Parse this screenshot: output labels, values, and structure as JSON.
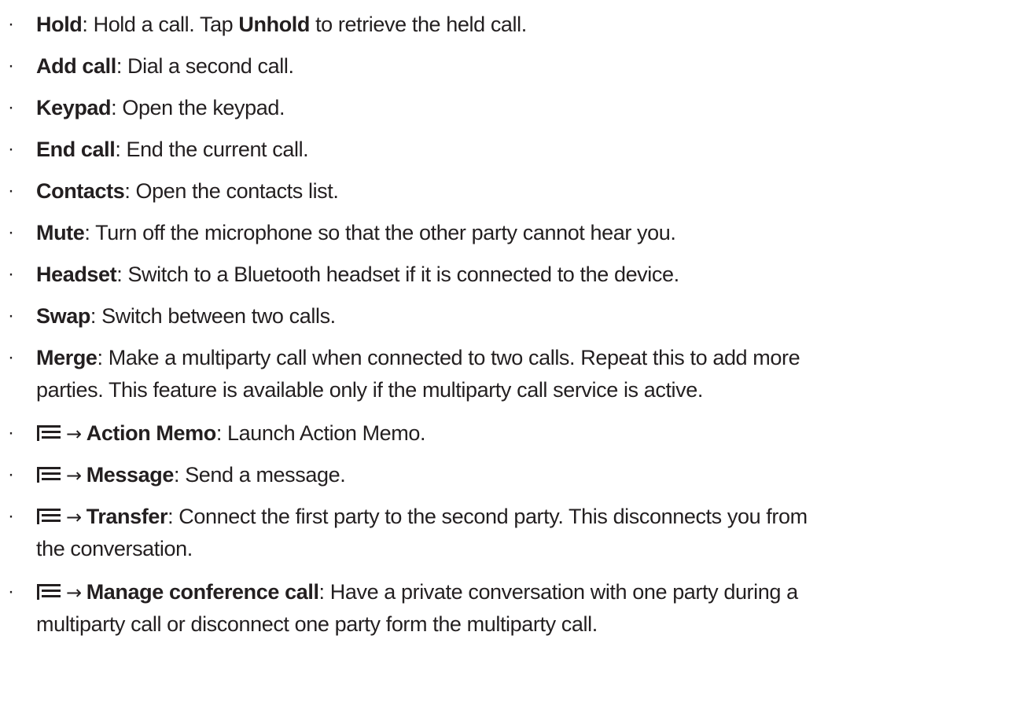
{
  "items": [
    {
      "term": "Hold",
      "sep": ": ",
      "text": "Hold a call. Tap ",
      "term2": "Unhold",
      "text2": " to retrieve the held call."
    },
    {
      "term": "Add call",
      "sep": ": ",
      "text": "Dial a second call."
    },
    {
      "term": "Keypad",
      "sep": ": ",
      "text": "Open the keypad."
    },
    {
      "term": "End call",
      "sep": ": ",
      "text": "End the current call."
    },
    {
      "term": "Contacts",
      "sep": ": ",
      "text": "Open the contacts list."
    },
    {
      "term": "Mute",
      "sep": ": ",
      "text": "Turn off the microphone so that the other party cannot hear you."
    },
    {
      "term": "Headset",
      "sep": ": ",
      "text": "Switch to a Bluetooth headset if it is connected to the device."
    },
    {
      "term": "Swap",
      "sep": ": ",
      "text": "Switch between two calls."
    },
    {
      "term": "Merge",
      "sep": ": ",
      "text": "Make a multiparty call when connected to two calls. Repeat this to add more",
      "line2": "parties. This feature is available only if the multiparty call service is active."
    },
    {
      "arrow": "→",
      "term": "Action Memo",
      "sep": ": ",
      "text": "Launch Action Memo."
    },
    {
      "arrow": "→",
      "term": "Message",
      "sep": ": ",
      "text": "Send a message."
    },
    {
      "arrow": "→",
      "term": "Transfer",
      "sep": ": ",
      "text": "Connect the first party to the second party. This disconnects you from",
      "line2": "the conversation."
    },
    {
      "arrow": "→",
      "term": "Manage conference call",
      "sep": ": ",
      "text": "Have a private conversation with one party during a",
      "line2": "multiparty call or disconnect one party form the multiparty call."
    }
  ],
  "bullet_char": "·",
  "icons": {
    "menu": "menu-icon"
  }
}
